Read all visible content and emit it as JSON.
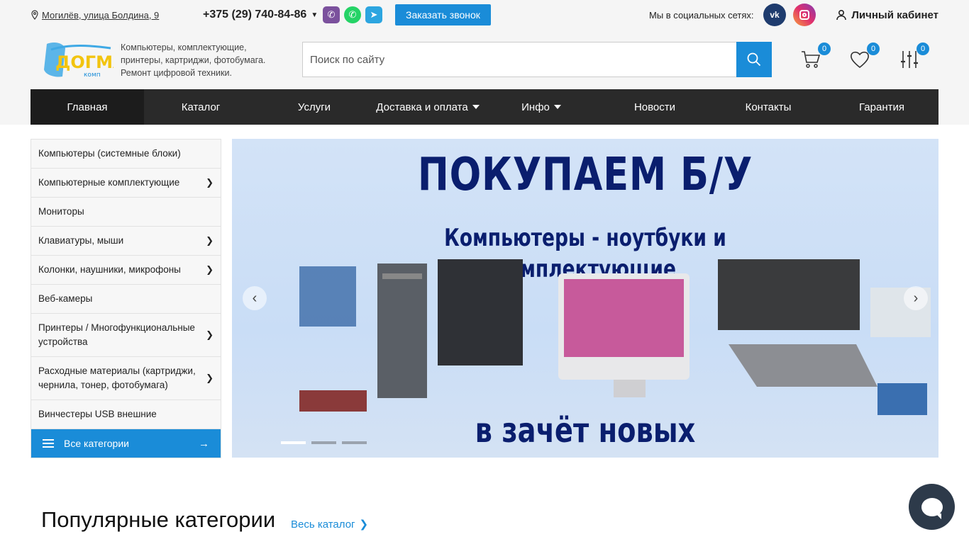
{
  "topbar": {
    "address": "Могилёв, улица Болдина, 9",
    "phone": "+375 (29) 740-84-86",
    "callback_button": "Заказать звонок",
    "social_label": "Мы в социальных сетях:",
    "account_label": "Личный кабинет",
    "vk_text": "vk"
  },
  "header": {
    "logo_text": "ДОГМА",
    "logo_sub": "комп",
    "tagline": "Компьютеры, комплектующие, принтеры, картриджи, фотобумага. Ремонт цифровой техники.",
    "search_placeholder": "Поиск по сайту",
    "cart_count": "0",
    "favorites_count": "0",
    "compare_count": "0"
  },
  "nav": {
    "items": [
      {
        "label": "Главная"
      },
      {
        "label": "Каталог"
      },
      {
        "label": "Услуги"
      },
      {
        "label": "Доставка и оплата"
      },
      {
        "label": "Инфо"
      },
      {
        "label": "Новости"
      },
      {
        "label": "Контакты"
      },
      {
        "label": "Гарантия"
      }
    ]
  },
  "sidebar": {
    "items": [
      {
        "label": "Компьютеры (системные блоки)"
      },
      {
        "label": "Компьютерные комплектующие"
      },
      {
        "label": "Мониторы"
      },
      {
        "label": "Клавиатуры, мыши"
      },
      {
        "label": "Колонки, наушники, микрофоны"
      },
      {
        "label": "Веб-камеры"
      },
      {
        "label": "Принтеры / Многофункциональные устройства"
      },
      {
        "label": "Расходные материалы (картриджи, чернила, тонер, фотобумага)"
      },
      {
        "label": "Винчестеры USB внешние"
      }
    ],
    "all_categories": "Все категории"
  },
  "banner": {
    "headline": "ПОКУПАЕМ Б/У",
    "line2": "Компьютеры - ноутбуки и",
    "line3": "комплектующие",
    "line4": "в зачёт новых"
  },
  "popular": {
    "title": "Популярные категории",
    "link": "Весь каталог"
  },
  "colors": {
    "accent": "#1a8cd8",
    "nav_bg": "#2a2a2a",
    "banner_text": "#0a1e6e"
  }
}
